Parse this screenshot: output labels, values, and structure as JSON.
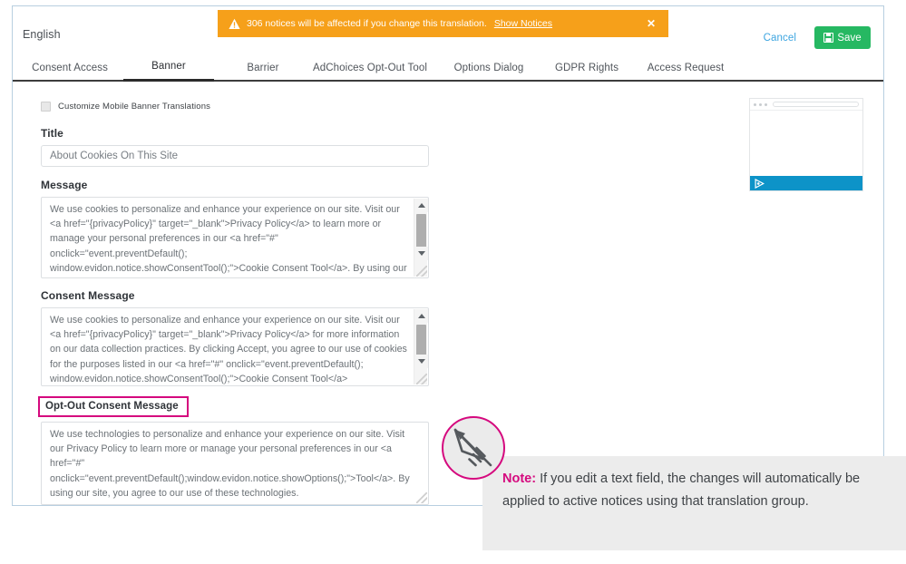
{
  "header": {
    "language_label": "English",
    "cancel_label": "Cancel",
    "save_label": "Save",
    "save_icon": "floppy-save-icon",
    "warning": {
      "icon": "warning-triangle-icon",
      "text": "306 notices will be affected if you change this translation.",
      "link_label": "Show Notices",
      "close_icon": "close-icon",
      "notice_count": "306",
      "background_color": "#f6a01a"
    }
  },
  "tabs": [
    {
      "label": "Consent Access",
      "active": false
    },
    {
      "label": "Banner",
      "active": true
    },
    {
      "label": "Barrier",
      "active": false
    },
    {
      "label": "AdChoices Opt-Out Tool",
      "active": false
    },
    {
      "label": "Options Dialog",
      "active": false
    },
    {
      "label": "GDPR Rights",
      "active": false
    },
    {
      "label": "Access Request",
      "active": false
    }
  ],
  "form": {
    "customize_checkbox": {
      "label": "Customize Mobile Banner Translations",
      "checked": false
    },
    "title": {
      "label": "Title",
      "value": "About Cookies On This Site",
      "placeholder": "About Cookies On This Site"
    },
    "message": {
      "label": "Message",
      "value": "We use cookies to personalize and enhance your experience on our site. Visit our <a href=\"{privacyPolicy}\" target=\"_blank\">Privacy Policy</a> to learn more or manage your personal preferences in our <a href=\"#\" onclick=\"event.preventDefault(); window.evidon.notice.showConsentTool();\">Cookie Consent Tool</a>. By using our site, you agree to our use of cookies."
    },
    "consent_message": {
      "label": "Consent Message",
      "value": "We use cookies to personalize and enhance your experience on our site. Visit our <a href=\"{privacyPolicy}\" target=\"_blank\">Privacy Policy</a> for more information on our data collection practices. By clicking Accept, you agree to our use of cookies for the purposes listed in our <a href=\"#\" onclick=\"event.preventDefault(); window.evidon.notice.showConsentTool();\">Cookie Consent Tool</a>"
    },
    "optout_consent_message": {
      "label": "Opt-Out Consent Message",
      "highlighted": true,
      "highlight_color": "#d5097e",
      "value": "We use technologies to personalize and enhance your experience on our site. Visit our Privacy Policy to learn more or manage your personal preferences in our <a href=\"#\" onclick=\"event.preventDefault();window.evidon.notice.showOptions();\">Tool</a>. By using our site, you agree to our use of these technologies."
    }
  },
  "preview": {
    "name": "banner-preview-thumbnail",
    "browser_dots": 3,
    "banner_bar_color": "#0d93c8",
    "banner_icon": "adchoices-play-icon"
  },
  "note": {
    "icon": "pencil-circle-icon",
    "keyword": "Note:",
    "text": " If you edit a text field, the changes will automatically be applied to active notices using that translation group.",
    "keyword_color": "#d5097e",
    "background_color": "#ececec"
  }
}
